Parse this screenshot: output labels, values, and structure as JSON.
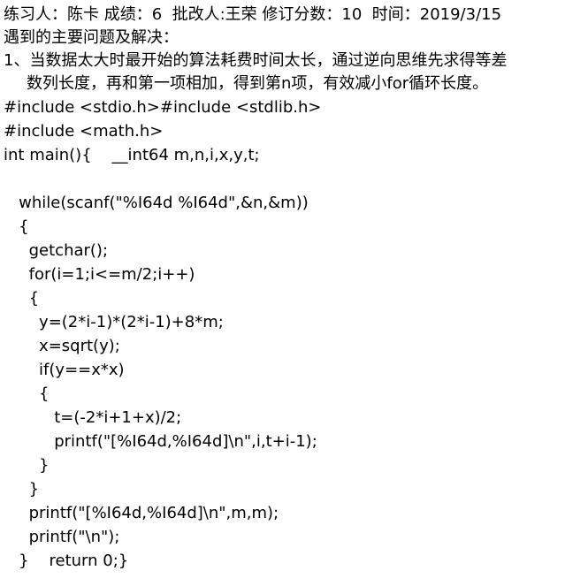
{
  "header": {
    "meta_line": "练习人：陈卡 成绩：6  批改人:王荣 修订分数：10  时间：2019/3/15",
    "problems_heading": "遇到的主要问题及解决：",
    "item1_line1": "1、当数据太大时最开始的算法耗费时间太长，通过逆向思维先求得等差",
    "item1_line2": "数列长度，再和第一项相加，得到第n项，有效减小for循环长度。"
  },
  "code": {
    "lines": [
      "#include <stdio.h>#include <stdlib.h>",
      "#include <math.h>",
      "int main(){    __int64 m,n,i,x,y,t;",
      "",
      "   while(scanf(\"%I64d %I64d\",&n,&m))",
      "   {",
      "     getchar();",
      "     for(i=1;i<=m/2;i++)",
      "     {",
      "       y=(2*i-1)*(2*i-1)+8*m;",
      "       x=sqrt(y);",
      "       if(y==x*x)",
      "       {",
      "          t=(-2*i+1+x)/2;",
      "          printf(\"[%I64d,%I64d]\\n\",i,t+i-1);",
      "       }",
      "     }",
      "     printf(\"[%I64d,%I64d]\\n\",m,m);",
      "     printf(\"\\n\");",
      "   }    return 0;}"
    ]
  }
}
